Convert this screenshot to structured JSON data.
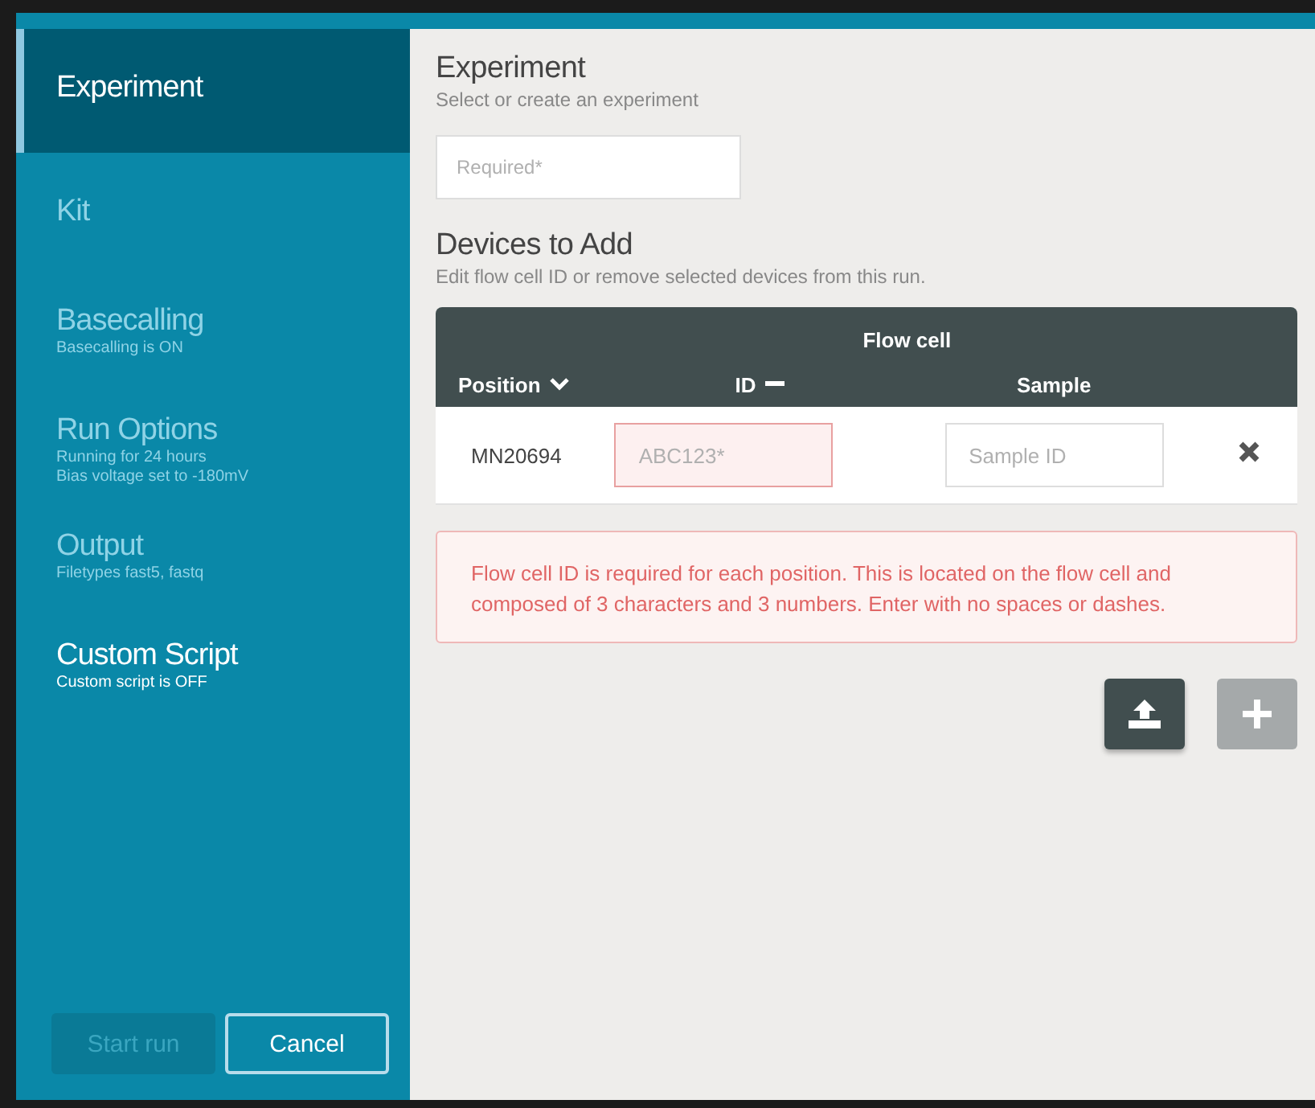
{
  "sidebar": {
    "items": [
      {
        "title": "Experiment",
        "selected": true,
        "disabled": false
      },
      {
        "title": "Kit",
        "selected": false,
        "disabled": true
      },
      {
        "title": "Basecalling",
        "lines": [
          "Basecalling is ON"
        ],
        "selected": false,
        "disabled": true
      },
      {
        "title": "Run Options",
        "lines": [
          "Running for 24 hours",
          "Bias voltage set to -180mV"
        ],
        "selected": false,
        "disabled": true
      },
      {
        "title": "Output",
        "lines": [
          "Filetypes fast5, fastq"
        ],
        "selected": false,
        "disabled": true
      },
      {
        "title": "Custom Script",
        "lines": [
          "Custom script is OFF"
        ],
        "selected": false,
        "disabled": false
      }
    ],
    "buttons": [
      {
        "label": "Start run",
        "disabled": true
      },
      {
        "label": "Cancel",
        "disabled": false
      }
    ]
  },
  "experiment": {
    "heading": "Experiment",
    "subtitle": "Select or create an experiment",
    "field": {
      "placeholder": "Required*"
    }
  },
  "devices": {
    "heading": "Devices to Add",
    "subtitle": "Edit flow cell ID or remove selected devices from this run.",
    "table": {
      "group_header": "Flow cell",
      "columns": [
        "Position",
        "ID",
        "Sample"
      ],
      "rows": [
        {
          "position": "MN20694",
          "id": {
            "placeholder": "ABC123*",
            "invalid": true
          },
          "sample": {
            "placeholder": "Sample ID"
          }
        }
      ]
    },
    "error": "Flow cell ID is required for each position. This is located on the flow cell and composed of 3 characters and 3 numbers. Enter with no spaces or dashes.",
    "actions": [
      {
        "kind": "upload",
        "disabled": false
      },
      {
        "kind": "add",
        "disabled": true
      }
    ]
  }
}
